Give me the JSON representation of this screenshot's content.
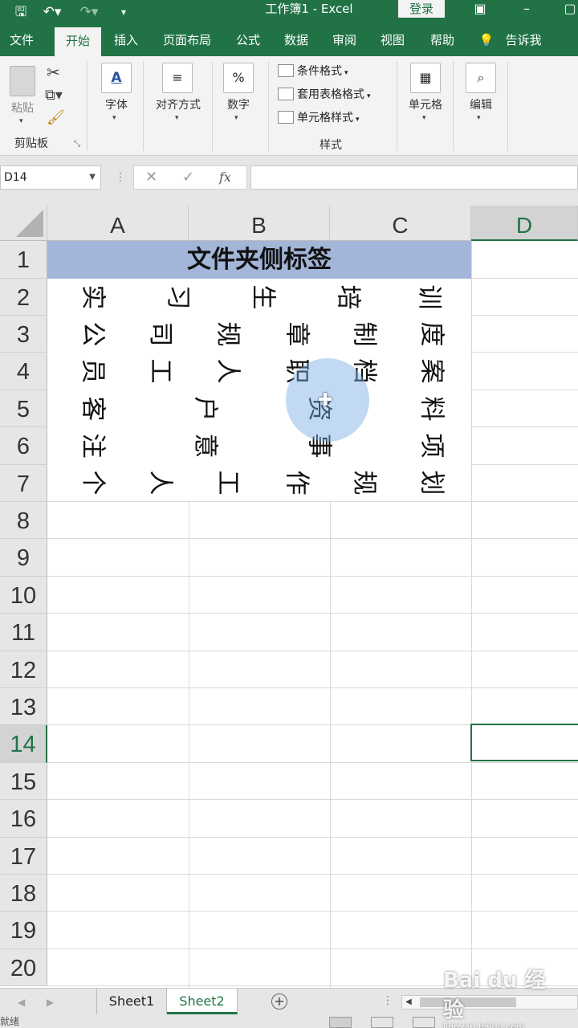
{
  "window": {
    "title": "工作簿1 - Excel",
    "login_label": "登录"
  },
  "ribbon_tabs": [
    {
      "label": "文件"
    },
    {
      "label": "开始"
    },
    {
      "label": "插入"
    },
    {
      "label": "页面布局"
    },
    {
      "label": "公式"
    },
    {
      "label": "数据"
    },
    {
      "label": "审阅"
    },
    {
      "label": "视图"
    },
    {
      "label": "帮助"
    },
    {
      "label": "告诉我"
    }
  ],
  "ribbon": {
    "clipboard": {
      "paste_label": "粘贴",
      "group_label": "剪贴板"
    },
    "font_label": "字体",
    "alignment_label": "对齐方式",
    "number_label": "数字",
    "styles": {
      "conditional_format": "条件格式",
      "table_format": "套用表格格式",
      "cell_styles": "单元格样式",
      "group_label": "样式"
    },
    "cells_label": "单元格",
    "editing_label": "编辑"
  },
  "formula_bar": {
    "name_box": "D14",
    "fx_label": "fx",
    "formula": ""
  },
  "columns": [
    {
      "label": "A"
    },
    {
      "label": "B"
    },
    {
      "label": "C"
    },
    {
      "label": "D"
    }
  ],
  "rows": [
    "1",
    "2",
    "3",
    "4",
    "5",
    "6",
    "7",
    "8",
    "9",
    "10",
    "11",
    "12",
    "13",
    "14",
    "15",
    "16",
    "17",
    "18",
    "19",
    "20"
  ],
  "sheet": {
    "title_cell": "文件夹侧标签",
    "title_color": "#a3b5d8",
    "char_rows": [
      [
        "实",
        "习",
        "生",
        "培",
        "训"
      ],
      [
        "公",
        "司",
        "规",
        "章",
        "制",
        "度"
      ],
      [
        "员",
        "工",
        "人",
        "职",
        "档",
        "案"
      ],
      [
        "客",
        "户",
        "资",
        "料"
      ],
      [
        "注",
        "意",
        "事",
        "项"
      ],
      [
        "个",
        "人",
        "工",
        "作",
        "规",
        "划"
      ]
    ],
    "selected_cell": "D14"
  },
  "sheet_tabs": [
    {
      "label": "Sheet1",
      "active": false
    },
    {
      "label": "Sheet2",
      "active": true
    }
  ],
  "status": {
    "ready_label": "就绪"
  },
  "watermark": {
    "brand": "Bai du 经验",
    "url": "jingyan.baidu.com"
  },
  "accent_color": "#217346"
}
